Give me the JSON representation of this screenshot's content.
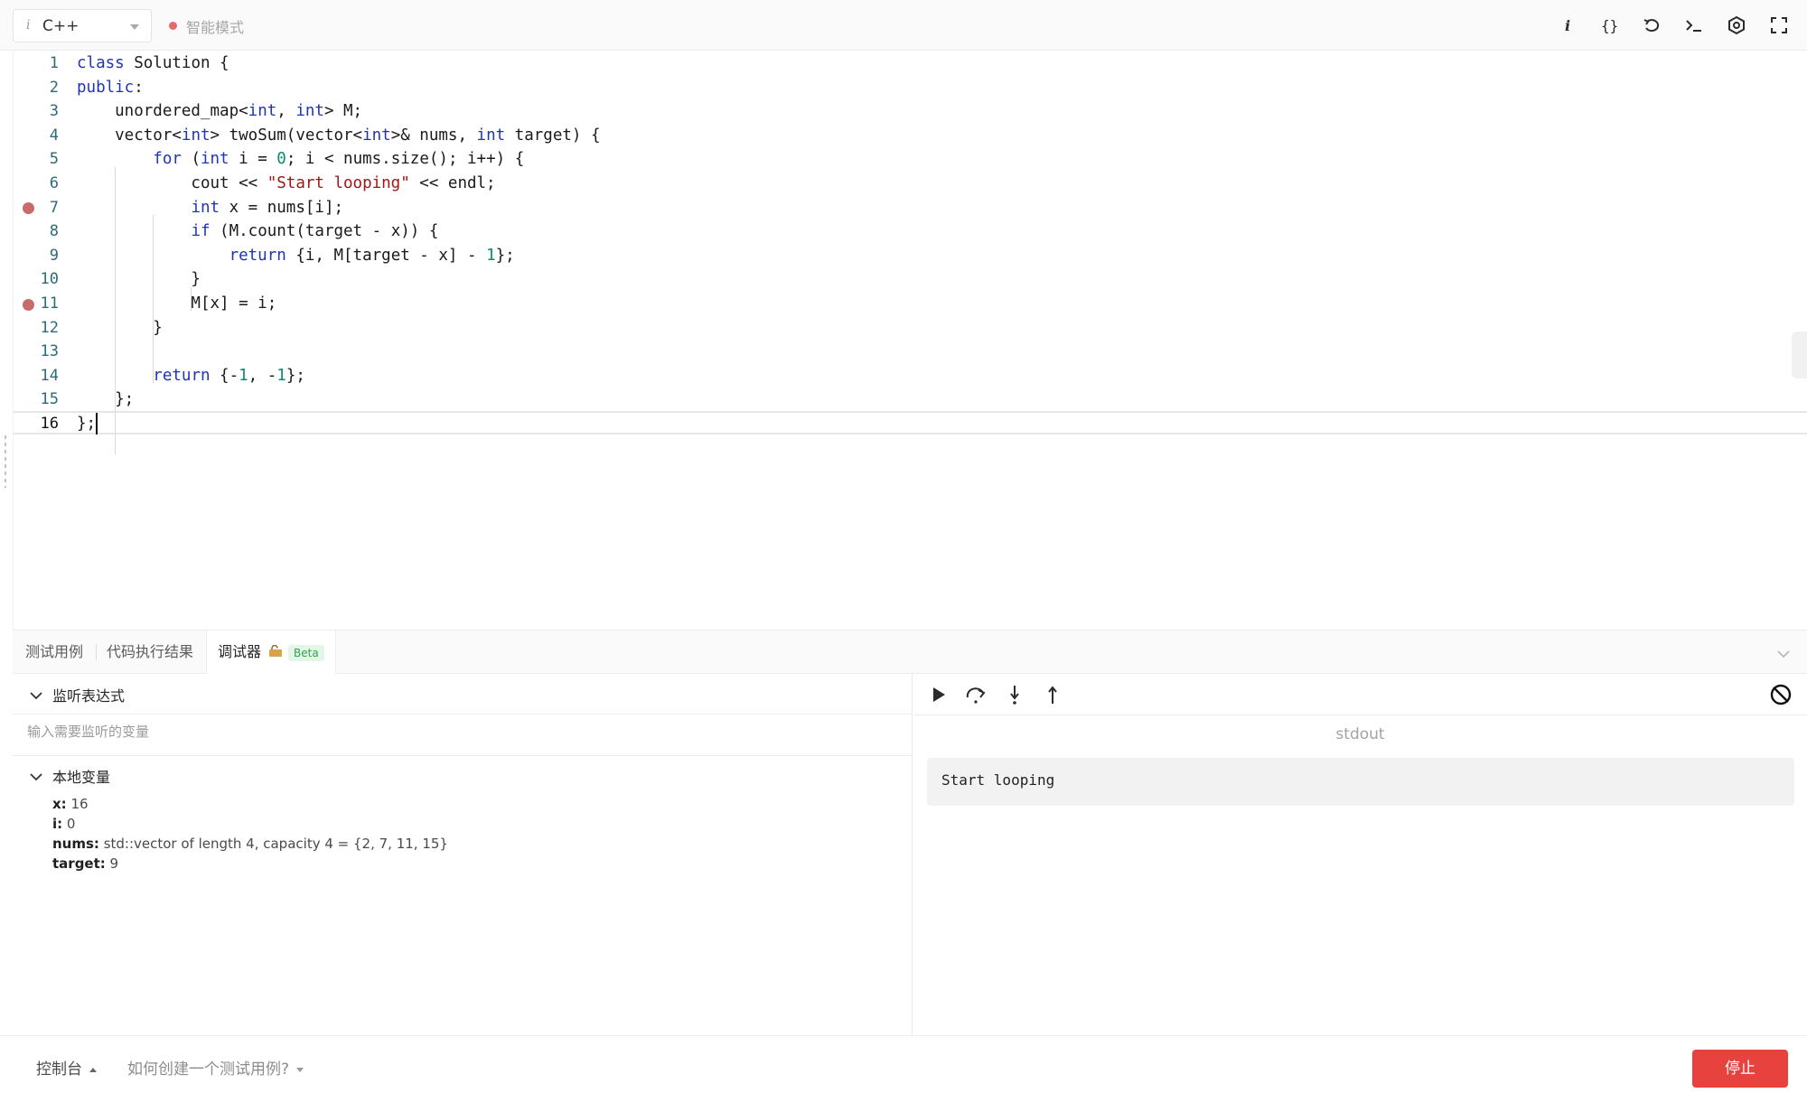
{
  "toolbar": {
    "language": "C++",
    "mode_label": "智能模式",
    "icons": [
      "info-icon",
      "format-braces-icon",
      "reset-icon",
      "terminal-icon",
      "settings-icon",
      "fullscreen-icon"
    ]
  },
  "editor": {
    "lines": [
      {
        "num": "1",
        "breakpoint": false
      },
      {
        "num": "2",
        "breakpoint": false
      },
      {
        "num": "3",
        "breakpoint": false
      },
      {
        "num": "4",
        "breakpoint": false
      },
      {
        "num": "5",
        "breakpoint": false
      },
      {
        "num": "6",
        "breakpoint": false
      },
      {
        "num": "7",
        "breakpoint": true
      },
      {
        "num": "8",
        "breakpoint": false
      },
      {
        "num": "9",
        "breakpoint": false
      },
      {
        "num": "10",
        "breakpoint": false
      },
      {
        "num": "11",
        "breakpoint": true
      },
      {
        "num": "12",
        "breakpoint": false
      },
      {
        "num": "13",
        "breakpoint": false
      },
      {
        "num": "14",
        "breakpoint": false
      },
      {
        "num": "15",
        "breakpoint": false
      },
      {
        "num": "16",
        "breakpoint": false
      }
    ],
    "code": {
      "l1_k": "class",
      "l1_r": " Solution {",
      "l2_k": "public",
      "l2_r": ":",
      "l3_a": "    unordered_map<",
      "l3_t1": "int",
      "l3_b": ", ",
      "l3_t2": "int",
      "l3_c": "> M;",
      "l4_a": "    vector<",
      "l4_t1": "int",
      "l4_b": "> twoSum(vector<",
      "l4_t2": "int",
      "l4_c": ">& nums, ",
      "l4_t3": "int",
      "l4_d": " target) {",
      "l5_a": "        ",
      "l5_k": "for",
      "l5_b": " (",
      "l5_t": "int",
      "l5_c": " i = ",
      "l5_n": "0",
      "l5_d": "; i < nums.size(); i++) {",
      "l6_a": "            cout << ",
      "l6_s": "\"Start looping\"",
      "l6_b": " << endl;",
      "l7_a": "            ",
      "l7_t": "int",
      "l7_b": " x = nums[i];",
      "l8_a": "            ",
      "l8_k": "if",
      "l8_b": " (M.count(target - x)) {",
      "l9_a": "                ",
      "l9_k": "return",
      "l9_b": " {i, M[target - x] - ",
      "l9_n": "1",
      "l9_c": "};",
      "l10": "            }",
      "l11": "            M[x] = i;",
      "l12": "        }",
      "l13": "",
      "l14_a": "        ",
      "l14_k": "return",
      "l14_b": " {-",
      "l14_n1": "1",
      "l14_c": ", -",
      "l14_n2": "1",
      "l14_d": "};",
      "l15": "    };",
      "l16": "};"
    }
  },
  "panel": {
    "tabs": [
      "测试用例",
      "代码执行结果",
      "调试器"
    ],
    "beta": "Beta"
  },
  "debugger": {
    "watch_title": "监听表达式",
    "watch_placeholder": "输入需要监听的变量",
    "locals_title": "本地变量",
    "locals": [
      {
        "name": "x:",
        "value": " 16"
      },
      {
        "name": "i:",
        "value": " 0"
      },
      {
        "name": "nums:",
        "value": " std::vector of length 4, capacity 4 = {2, 7, 11, 15}"
      },
      {
        "name": "target:",
        "value": " 9"
      }
    ],
    "stdout_label": "stdout",
    "stdout_text": "Start looping"
  },
  "footer": {
    "console": "控制台",
    "help": "如何创建一个测试用例?",
    "stop": "停止"
  },
  "colors": {
    "keyword": "#1f35b5",
    "string": "#a31515",
    "number": "#0f8a6e",
    "breakpoint": "#c96b6b",
    "stop_button": "#e8423f",
    "beta_badge": "#2fa24a"
  }
}
